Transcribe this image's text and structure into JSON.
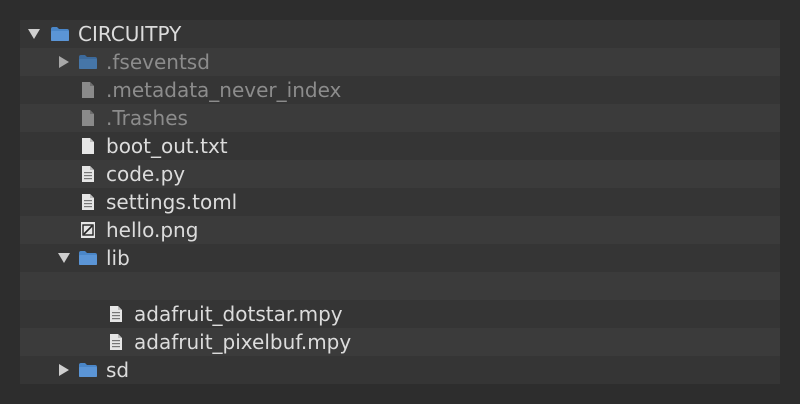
{
  "tree": {
    "root": {
      "label": "CIRCUITPY",
      "icon": "folder-icon",
      "expanded": true
    },
    "items": [
      {
        "label": ".fseventsd",
        "icon": "folder-icon",
        "expanded": false
      },
      {
        "label": ".metadata_never_index",
        "icon": "file-icon"
      },
      {
        "label": ".Trashes",
        "icon": "file-icon"
      },
      {
        "label": "boot_out.txt",
        "icon": "file-icon"
      },
      {
        "label": "code.py",
        "icon": "source-file-icon"
      },
      {
        "label": "settings.toml",
        "icon": "source-file-icon"
      },
      {
        "label": "hello.png",
        "icon": "image-file-icon"
      },
      {
        "label": "lib",
        "icon": "folder-icon",
        "expanded": true
      },
      {
        "label": "adafruit_dotstar.mpy",
        "icon": "source-file-icon"
      },
      {
        "label": "adafruit_pixelbuf.mpy",
        "icon": "source-file-icon"
      },
      {
        "label": "sd",
        "icon": "folder-icon",
        "expanded": false
      }
    ]
  },
  "colors": {
    "background": "#2d2d2d",
    "panel": "#353535",
    "row_alt": "#3b3b3b",
    "text": "#dcdcdc",
    "muted_text": "#8c8c8c",
    "folder_blue": "#4a86c8",
    "folder_blue_muted": "#3c6a9c"
  }
}
